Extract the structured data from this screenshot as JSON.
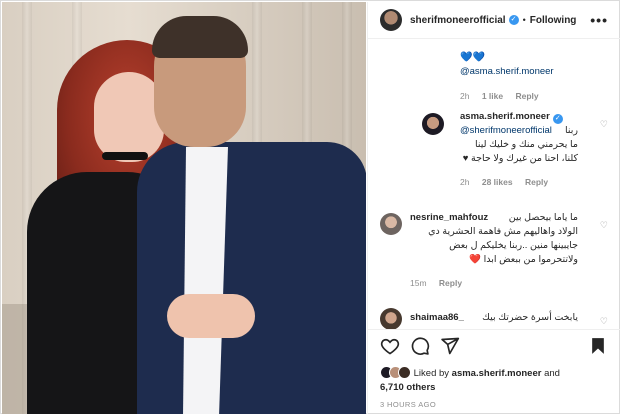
{
  "header": {
    "username": "sherifmoneerofficial",
    "dot": "•",
    "follow_label": "Following",
    "more_label": "•••"
  },
  "comments": [
    {
      "text_hearts": "💙💙",
      "mention": "@asma.sherif.moneer",
      "time": "2h",
      "likes": "1 like",
      "reply": "Reply"
    },
    {
      "username": "asma.sherif.moneer",
      "mention": "@sherifmoneerofficial",
      "line1": "ربنا",
      "line2": "ما يحرمني منك و خليك لينا",
      "line3": "كلنا، احنا من غيرك ولا حاجة ♥",
      "time": "2h",
      "likes": "28 likes",
      "reply": "Reply"
    },
    {
      "username": "nesrine_mahfouz",
      "line1": "ما ياما بيحصل بين",
      "line2": "الولاد واهاليهم مش فاهمة الحشرية دي",
      "line3": "جايبينها منين ..ربنا يخليكم ل بعض",
      "line4": "ولاتتحرموا من ببعض ابدا ❤️",
      "time": "15m",
      "reply": "Reply"
    },
    {
      "username": "shaimaa86_",
      "line1": "يابخت أسرة حضرتك بيك"
    }
  ],
  "likes": {
    "prefix": "Liked by",
    "user": "asma.sherif.moneer",
    "and": "and",
    "others": "6,710 others"
  },
  "time_ago": "3 HOURS AGO",
  "colors": {
    "verified": "#3897f0",
    "mention": "#00376b",
    "muted": "#8e8e8e",
    "heart_red": "#ed4956"
  }
}
